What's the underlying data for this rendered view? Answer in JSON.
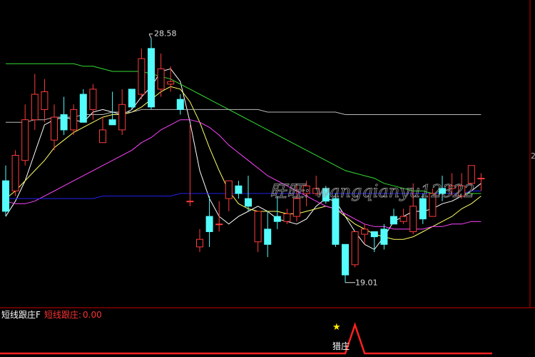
{
  "main_chart": {
    "high_label": "28.58",
    "low_label": "19.01",
    "right_edge_label": "2",
    "watermark": "旺旺: wangqianyu12322",
    "colors": {
      "up": "#ff3b3b",
      "down": "#54fcfc",
      "bg": "#000000",
      "ma_white": "#ffffff",
      "ma_yellow": "#ffff66",
      "ma_magenta": "#ff44ff",
      "ma_green": "#33dd33",
      "ma_blue": "#2222ee",
      "ma_gray": "#b8b8b8",
      "axis_red": "#cc0000"
    }
  },
  "indicator": {
    "name": "短线跟庄F",
    "series_label": "短线跟庄:",
    "value": "0.00",
    "signal_label": "猎庄",
    "signal_icon": "star-icon"
  },
  "chart_data": {
    "type": "candlestick",
    "ohlc": [
      [
        23.0,
        23.6,
        21.6,
        21.8
      ],
      [
        22.6,
        24.2,
        22.4,
        24.0
      ],
      [
        23.8,
        26.0,
        23.6,
        25.4
      ],
      [
        25.4,
        27.2,
        25.0,
        26.4
      ],
      [
        25.8,
        27.0,
        25.3,
        26.5
      ],
      [
        24.6,
        26.0,
        24.2,
        25.5
      ],
      [
        25.6,
        26.3,
        24.8,
        25.0
      ],
      [
        25.0,
        26.0,
        24.8,
        25.8
      ],
      [
        26.4,
        26.6,
        25.3,
        25.3
      ],
      [
        25.8,
        26.8,
        25.4,
        26.6
      ],
      [
        24.5,
        25.5,
        24.5,
        25.0
      ],
      [
        25.4,
        26.5,
        25.2,
        25.2
      ],
      [
        25.0,
        26.6,
        24.8,
        26.0
      ],
      [
        26.6,
        26.6,
        25.8,
        25.9
      ],
      [
        26.4,
        28.2,
        26.2,
        27.8
      ],
      [
        28.2,
        28.6,
        25.8,
        25.9
      ],
      [
        26.6,
        28.0,
        26.3,
        27.4
      ],
      [
        26.8,
        27.5,
        26.5,
        26.9
      ],
      [
        26.2,
        26.4,
        25.6,
        25.8
      ],
      [
        22.2,
        25.2,
        22.0,
        22.2
      ],
      [
        20.4,
        21.1,
        20.2,
        20.7
      ],
      [
        21.6,
        22.4,
        20.4,
        21.0
      ],
      [
        21.3,
        22.2,
        21.0,
        21.3
      ],
      [
        22.3,
        23.0,
        21.8,
        23.0
      ],
      [
        22.8,
        23.0,
        22.3,
        22.5
      ],
      [
        22.3,
        23.2,
        21.8,
        22.0
      ],
      [
        20.6,
        21.6,
        20.2,
        21.8
      ],
      [
        21.1,
        21.8,
        20.0,
        20.5
      ],
      [
        21.6,
        22.4,
        21.1,
        21.4
      ],
      [
        21.4,
        21.9,
        21.3,
        21.7
      ],
      [
        21.6,
        22.9,
        21.4,
        22.3
      ],
      [
        22.5,
        23.0,
        22.0,
        22.8
      ],
      [
        22.5,
        23.2,
        22.4,
        22.7
      ],
      [
        22.7,
        22.8,
        22.1,
        22.2
      ],
      [
        22.3,
        22.5,
        20.4,
        20.5
      ],
      [
        20.5,
        20.5,
        19.0,
        19.3
      ],
      [
        19.7,
        21.0,
        19.6,
        21.0
      ],
      [
        20.9,
        21.3,
        20.5,
        21.1
      ],
      [
        21.0,
        21.0,
        20.2,
        20.8
      ],
      [
        21.1,
        21.3,
        20.3,
        20.5
      ],
      [
        21.6,
        21.9,
        21.3,
        21.3
      ],
      [
        21.4,
        21.9,
        21.3,
        21.6
      ],
      [
        21.0,
        22.9,
        20.9,
        22.0
      ],
      [
        22.3,
        22.5,
        21.3,
        21.5
      ],
      [
        21.6,
        22.7,
        21.6,
        22.5
      ],
      [
        22.7,
        23.2,
        22.2,
        22.5
      ],
      [
        22.7,
        23.3,
        22.4,
        22.8
      ],
      [
        22.4,
        23.3,
        22.3,
        22.8
      ],
      [
        22.9,
        23.6,
        22.8,
        23.6
      ],
      [
        23.1,
        23.3,
        22.6,
        23.1
      ]
    ],
    "ma_lines": [
      {
        "name": "",
        "color": "#ffffff",
        "values": [
          21.6,
          22.2,
          23.0,
          24.1,
          25.2,
          25.4,
          25.5,
          25.4,
          25.3,
          25.7,
          25.8,
          25.7,
          25.6,
          25.8,
          26.3,
          26.7,
          27.3,
          27.4,
          26.9,
          25.3,
          23.4,
          22.3,
          21.6,
          21.3,
          21.6,
          21.8,
          22.0,
          21.8,
          21.5,
          21.4,
          21.3,
          21.5,
          22.0,
          22.3,
          22.2,
          21.6,
          21.0,
          20.5,
          20.3,
          20.8,
          21.4,
          21.6,
          21.8,
          21.8,
          21.9,
          22.1,
          22.2,
          22.4,
          22.6,
          22.9
        ]
      },
      {
        "name": "",
        "color": "#ffff66",
        "values": [
          22.3,
          22.6,
          23.0,
          23.4,
          23.8,
          24.3,
          24.6,
          24.9,
          25.1,
          25.3,
          25.5,
          25.6,
          25.6,
          25.7,
          25.9,
          26.2,
          26.5,
          26.7,
          26.6,
          26.1,
          25.3,
          24.3,
          23.4,
          22.6,
          22.1,
          21.9,
          21.8,
          21.8,
          21.8,
          21.7,
          21.7,
          21.8,
          21.9,
          22.0,
          21.9,
          21.6,
          21.3,
          21.1,
          20.9,
          20.8,
          20.7,
          20.7,
          20.8,
          21.0,
          21.2,
          21.4,
          21.6,
          21.9,
          22.1,
          22.4
        ]
      },
      {
        "name": "",
        "color": "#ff44ff",
        "values": [
          22.2,
          22.1,
          22.1,
          22.2,
          22.4,
          22.6,
          22.8,
          23.0,
          23.2,
          23.4,
          23.6,
          23.8,
          24.0,
          24.2,
          24.5,
          24.7,
          25.0,
          25.2,
          25.4,
          25.4,
          25.3,
          25.1,
          24.8,
          24.4,
          24.1,
          23.8,
          23.5,
          23.2,
          23.0,
          22.8,
          22.6,
          22.4,
          22.2,
          22.0,
          21.9,
          21.7,
          21.5,
          21.3,
          21.2,
          21.2,
          21.1,
          21.1,
          21.1,
          21.1,
          21.2,
          21.2,
          21.3,
          21.3,
          21.4,
          21.4
        ]
      },
      {
        "name": "",
        "color": "#33dd33",
        "values": [
          27.6,
          27.6,
          27.6,
          27.6,
          27.6,
          27.6,
          27.6,
          27.6,
          27.5,
          27.5,
          27.4,
          27.3,
          27.3,
          27.3,
          27.3,
          27.2,
          27.1,
          27.0,
          26.8,
          26.6,
          26.4,
          26.2,
          26.0,
          25.8,
          25.6,
          25.4,
          25.2,
          25.0,
          24.8,
          24.6,
          24.4,
          24.2,
          24.0,
          23.8,
          23.6,
          23.4,
          23.3,
          23.2,
          23.1,
          22.9,
          22.8,
          22.7,
          22.6,
          22.6,
          22.5,
          22.5,
          22.5,
          22.5,
          22.5,
          22.5
        ]
      },
      {
        "name": "",
        "color": "#b8b8b8",
        "values": [
          25.3,
          25.3,
          25.3,
          25.4,
          25.4,
          25.5,
          25.5,
          25.5,
          25.6,
          25.6,
          25.6,
          25.7,
          25.7,
          25.7,
          25.8,
          25.8,
          25.8,
          25.8,
          25.8,
          25.8,
          25.8,
          25.8,
          25.8,
          25.8,
          25.8,
          25.8,
          25.8,
          25.7,
          25.7,
          25.7,
          25.7,
          25.7,
          25.7,
          25.7,
          25.7,
          25.6,
          25.6,
          25.6,
          25.6,
          25.6,
          25.6,
          25.6,
          25.6,
          25.6,
          25.6,
          25.6,
          25.6,
          25.6,
          25.6,
          25.6
        ]
      },
      {
        "name": "",
        "color": "#2222ee",
        "values": [
          22.3,
          22.3,
          22.3,
          22.3,
          22.3,
          22.3,
          22.3,
          22.3,
          22.3,
          22.3,
          22.4,
          22.4,
          22.4,
          22.4,
          22.4,
          22.4,
          22.4,
          22.4,
          22.5,
          22.5,
          22.5,
          22.5,
          22.5,
          22.5,
          22.5,
          22.5,
          22.5,
          22.5,
          22.5,
          22.5,
          22.5,
          22.5,
          22.5,
          22.5,
          22.5,
          22.5,
          22.5,
          22.5,
          22.5,
          22.5,
          22.5,
          22.5,
          22.5,
          22.5,
          22.5,
          22.5,
          22.5,
          22.5,
          22.6,
          22.6
        ]
      }
    ],
    "indicator_series": [
      0,
      0,
      0,
      0,
      0,
      0,
      0,
      0,
      0,
      0,
      0,
      0,
      0,
      0,
      0,
      0,
      0,
      0,
      0,
      0,
      0,
      0,
      0,
      0,
      0,
      0,
      0,
      0,
      0,
      0,
      0,
      0,
      0,
      0,
      0,
      0,
      1,
      0,
      0,
      0,
      0,
      0,
      0,
      0,
      0,
      0,
      0,
      0,
      0,
      0
    ],
    "annotations": [
      "28.58",
      "19.01"
    ]
  }
}
